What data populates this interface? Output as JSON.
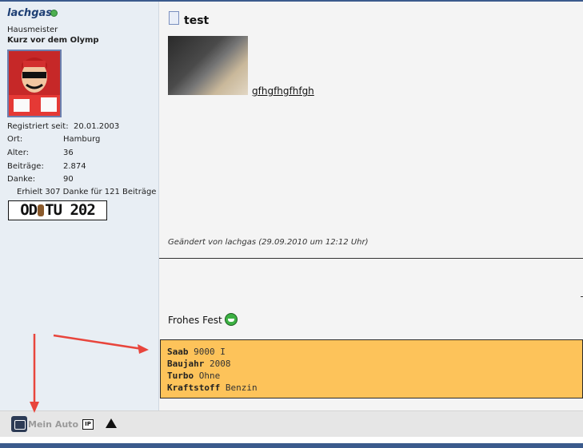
{
  "profile": {
    "username": "lachgas",
    "rank": "Hausmeister",
    "title": "Kurz vor dem Olymp",
    "info": [
      {
        "label": "Registriert seit:",
        "value": "20.01.2003"
      },
      {
        "label": "Ort:",
        "value": "Hamburg"
      },
      {
        "label": "Alter:",
        "value": "36"
      },
      {
        "label": "Beiträge:",
        "value": "2.874"
      },
      {
        "label": "Danke:",
        "value": "90"
      }
    ],
    "thanks_line": "Erhielt 307 Danke für 121 Beiträge",
    "plate": {
      "left": "OD",
      "right": "TU 202"
    }
  },
  "post": {
    "title": "test",
    "link_text": "gfhgfhgfhfgh",
    "edited": "Geändert von lachgas (29.09.2010 um 12:12 Uhr)",
    "greeting": "Frohes Fest"
  },
  "car": {
    "rows": [
      {
        "label": "Saab",
        "value": "9000 I"
      },
      {
        "label": "Baujahr",
        "value": "2008"
      },
      {
        "label": "Turbo",
        "value": "Ohne"
      },
      {
        "label": "Kraftstoff",
        "value": "Benzin"
      }
    ]
  },
  "bottombar": {
    "mein_auto_label": "Mein Auto",
    "ip_label": "IP"
  },
  "colors": {
    "accent": "#3b5a8c",
    "car_box": "#fdc35a",
    "arrow": "#e8453c"
  }
}
